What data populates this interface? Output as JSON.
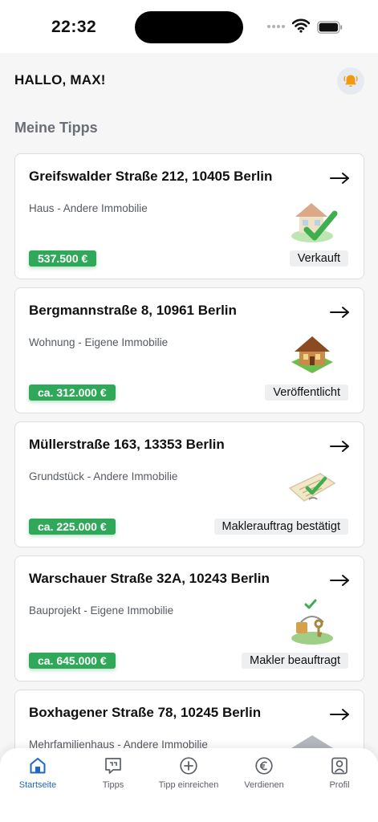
{
  "status_bar": {
    "time": "22:32"
  },
  "header": {
    "greeting": "HALLO, MAX!",
    "bell_icon": "bell-icon"
  },
  "section": {
    "title": "Meine Tipps"
  },
  "colors": {
    "price_green": "#2fa85a",
    "accent_blue": "#1f66c7",
    "bell_orange": "#f29a0f"
  },
  "tips": [
    {
      "address": "Greifswalder Straße 212, 10405 Berlin",
      "type": "Haus - Andere Immobilie",
      "price": "537.500 €",
      "status": "Verkauft",
      "illustration": "house-check-icon"
    },
    {
      "address": "Bergmannstraße 8, 10961 Berlin",
      "type": "Wohnung - Eigene Immobilie",
      "price": "ca. 312.000 €",
      "status": "Veröffentlicht",
      "illustration": "house-icon"
    },
    {
      "address": "Müllerstraße 163, 13353 Berlin",
      "type": "Grundstück - Andere Immobilie",
      "price": "ca. 225.000 €",
      "status": "Maklerauftrag bestätigt",
      "illustration": "contract-icon"
    },
    {
      "address": "Warschauer Straße 32A, 10243 Berlin",
      "type": "Bauprojekt - Eigene Immobilie",
      "price": "ca. 645.000 €",
      "status": "Makler beauftragt",
      "illustration": "keys-icon"
    },
    {
      "address": "Boxhagener Straße 78, 10245 Berlin",
      "type": "Mehrfamilienhaus - Andere Immobilie",
      "price": "",
      "status": "",
      "illustration": "building-icon"
    }
  ],
  "tabbar": {
    "items": [
      {
        "label": "Startseite",
        "icon": "home-icon",
        "active": true
      },
      {
        "label": "Tipps",
        "icon": "chat-icon",
        "active": false
      },
      {
        "label": "Tipp einreichen",
        "icon": "plus-circle-icon",
        "active": false
      },
      {
        "label": "Verdienen",
        "icon": "euro-icon",
        "active": false
      },
      {
        "label": "Profil",
        "icon": "profile-icon",
        "active": false
      }
    ]
  }
}
